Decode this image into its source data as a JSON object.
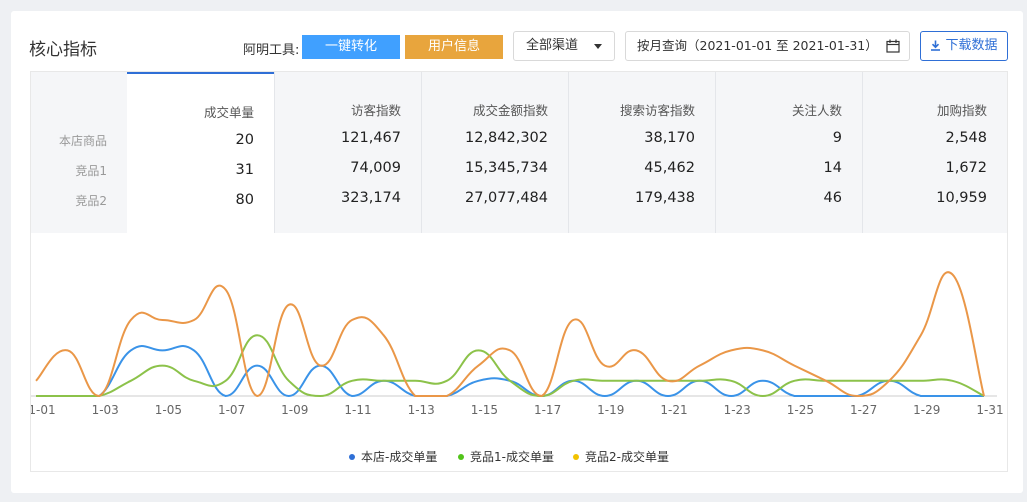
{
  "header": {
    "title": "核心指标",
    "tool_label": "阿明工具:",
    "btn_convert": "一键转化",
    "btn_user_info": "用户信息",
    "channel_select": "全部渠道",
    "date_range": "按月查询（2021-01-01 至 2021-01-31）",
    "download": "下载数据"
  },
  "table": {
    "row_labels": [
      "本店商品",
      "竞品1",
      "竞品2"
    ],
    "metrics": [
      {
        "label": "成交单量",
        "values": [
          "20",
          "31",
          "80"
        ]
      },
      {
        "label": "访客指数",
        "values": [
          "121,467",
          "74,009",
          "323,174"
        ]
      },
      {
        "label": "成交金额指数",
        "values": [
          "12,842,302",
          "15,345,734",
          "27,077,484"
        ]
      },
      {
        "label": "搜索访客指数",
        "values": [
          "38,170",
          "45,462",
          "179,438"
        ]
      },
      {
        "label": "关注人数",
        "values": [
          "9",
          "14",
          "46"
        ]
      },
      {
        "label": "加购指数",
        "values": [
          "2,548",
          "1,672",
          "10,959"
        ]
      }
    ]
  },
  "colors": {
    "series_blue": "#3a93e8",
    "series_green": "#8cc24a",
    "series_orange": "#ea9748",
    "legend_blue": "#2f6fd6",
    "legend_green": "#52c41a",
    "legend_orange": "#f2c200",
    "accent": "#2f6fd6"
  },
  "chart_data": {
    "type": "line",
    "categories": [
      "1-01",
      "1-02",
      "1-03",
      "1-04",
      "1-05",
      "1-06",
      "1-07",
      "1-08",
      "1-09",
      "1-10",
      "1-11",
      "1-12",
      "1-13",
      "1-14",
      "1-15",
      "1-16",
      "1-17",
      "1-18",
      "1-19",
      "1-20",
      "1-21",
      "1-22",
      "1-23",
      "1-24",
      "1-25",
      "1-26",
      "1-27",
      "1-28",
      "1-29",
      "1-30",
      "1-31"
    ],
    "x_tick_labels": [
      "1-01",
      "1-03",
      "1-05",
      "1-07",
      "1-09",
      "1-11",
      "1-13",
      "1-15",
      "1-17",
      "1-19",
      "1-21",
      "1-23",
      "1-25",
      "1-27",
      "1-29",
      "1-31"
    ],
    "series": [
      {
        "name": "本店-成交单量",
        "values": [
          0,
          0,
          0,
          3,
          3,
          3,
          0,
          2,
          0,
          2,
          0,
          1,
          0,
          0,
          1,
          1,
          0,
          1,
          0,
          1,
          0,
          1,
          0,
          1,
          0,
          0,
          0,
          1,
          0,
          0,
          0
        ]
      },
      {
        "name": "竞品1-成交单量",
        "values": [
          0,
          0,
          0,
          1,
          2,
          1,
          1,
          4,
          1,
          0,
          1,
          1,
          1,
          1,
          3,
          1,
          0,
          1,
          1,
          1,
          1,
          1,
          1,
          0,
          1,
          1,
          1,
          1,
          1,
          1,
          0
        ]
      },
      {
        "name": "竞品2-成交单量",
        "values": [
          1,
          3,
          0,
          5,
          5,
          5,
          7,
          0,
          6,
          2,
          5,
          4,
          0,
          0,
          2,
          3,
          0,
          5,
          2,
          3,
          1,
          2,
          3,
          3,
          2,
          1,
          0,
          1,
          4,
          8,
          0
        ]
      }
    ],
    "legend": [
      "本店-成交单量",
      "竞品1-成交单量",
      "竞品2-成交单量"
    ],
    "legend_position": "bottom-center",
    "grid": false
  }
}
